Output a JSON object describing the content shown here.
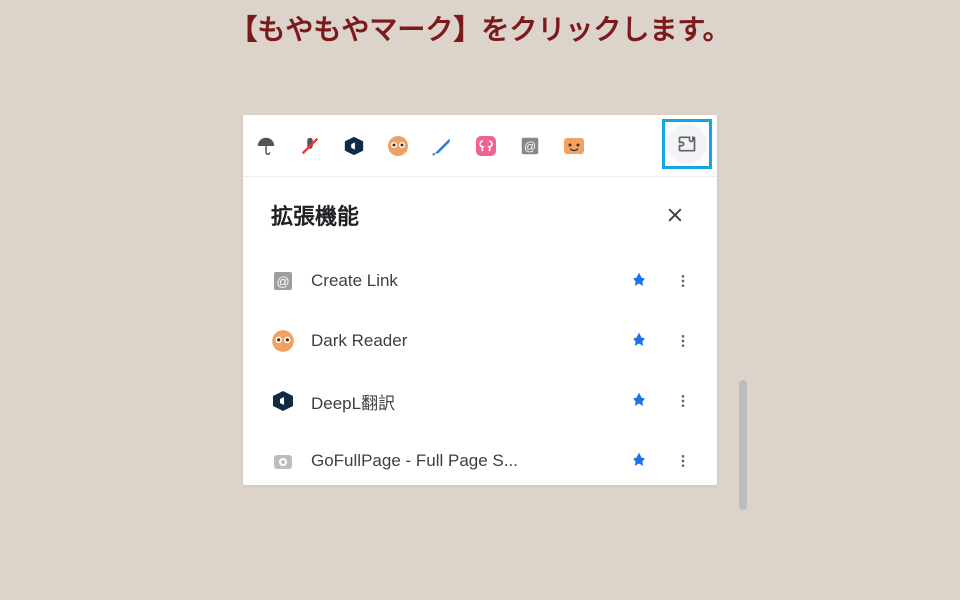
{
  "instruction": "【もやもやマーク】をクリックします。",
  "toolbar": {
    "icons": [
      {
        "name": "umbrella-icon"
      },
      {
        "name": "mic-off-icon"
      },
      {
        "name": "deepl-icon"
      },
      {
        "name": "darkreader-icon"
      },
      {
        "name": "feather-icon"
      },
      {
        "name": "brain-icon"
      },
      {
        "name": "link-at-icon"
      },
      {
        "name": "face-icon"
      }
    ]
  },
  "panel": {
    "title": "拡張機能",
    "extensions": [
      {
        "icon": "create-link-icon",
        "label": "Create Link"
      },
      {
        "icon": "dark-reader-icon",
        "label": "Dark Reader"
      },
      {
        "icon": "deepl-translate-icon",
        "label": "DeepL翻訳"
      },
      {
        "icon": "gofullpage-icon",
        "label": "GoFullPage - Full Page S..."
      }
    ]
  },
  "colors": {
    "pin": "#1a73e8",
    "highlight": "#14a6e4"
  }
}
